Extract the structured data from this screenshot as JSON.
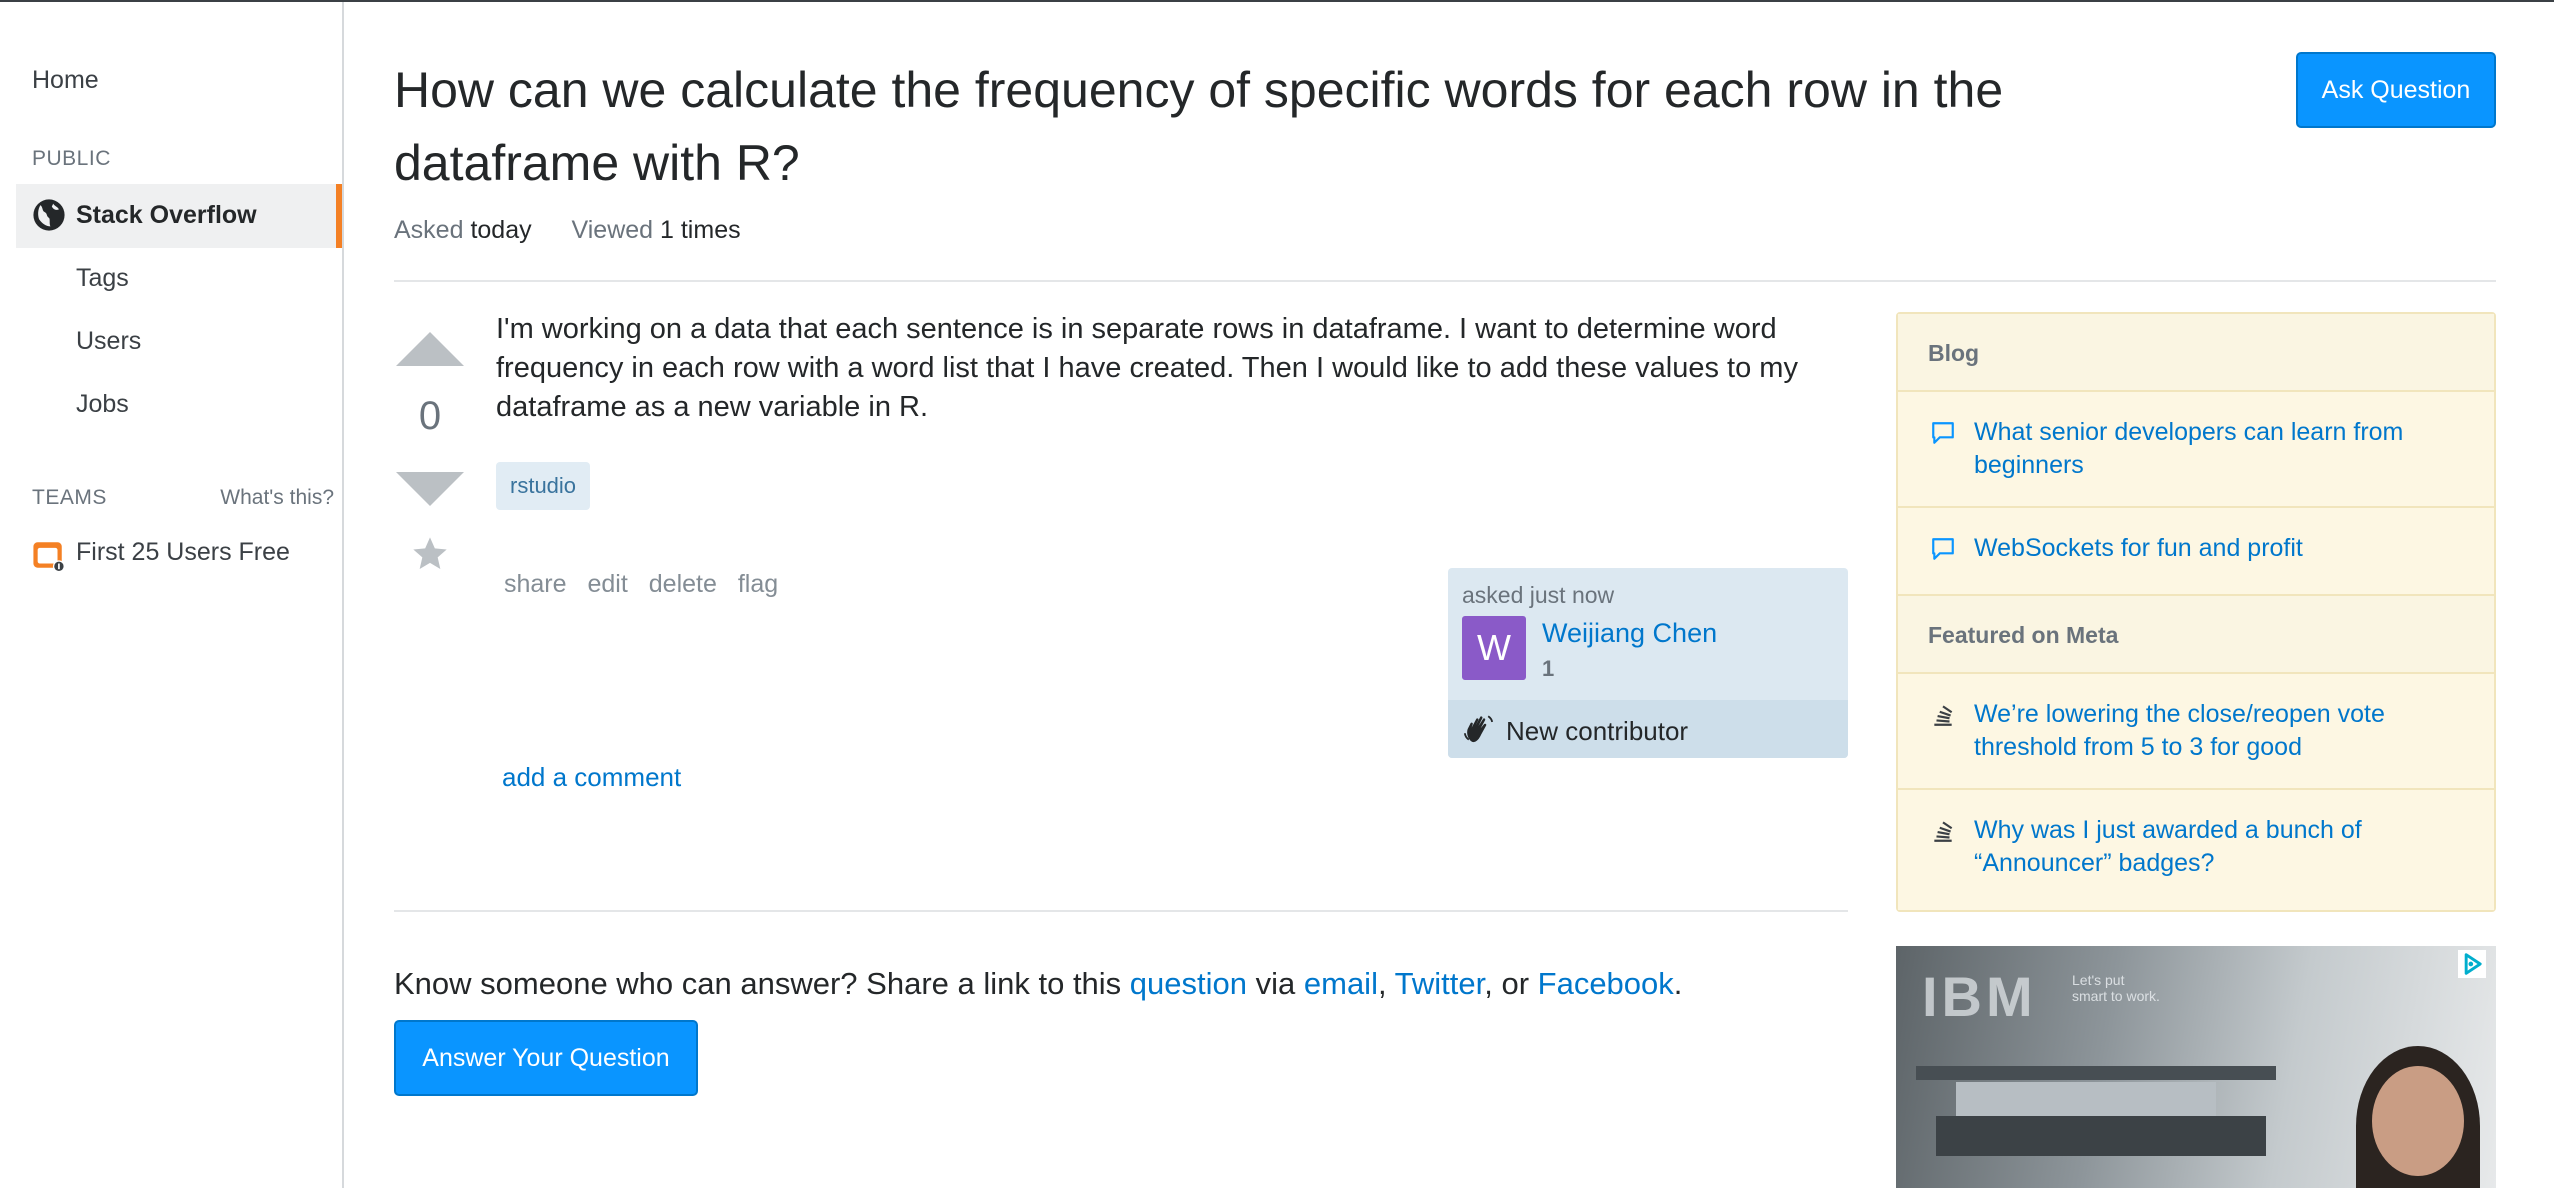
{
  "sidebar": {
    "home": "Home",
    "public_label": "PUBLIC",
    "stack_overflow": "Stack Overflow",
    "tags": "Tags",
    "users": "Users",
    "jobs": "Jobs",
    "teams_label": "TEAMS",
    "whats_this": "What's this?",
    "teams_free": "First 25 Users Free"
  },
  "question": {
    "title": "How can we calculate the frequency of specific words for each row in the dataframe with R?",
    "ask_button": "Ask Question",
    "asked_label": "Asked",
    "asked_value": "today",
    "viewed_label": "Viewed",
    "viewed_value": "1 times",
    "vote_count": "0",
    "body": "I'm working on a data that each sentence is in separate rows in dataframe. I want to determine word frequency in each row with a word list that I have created. Then I would like to add these values to my dataframe as a new variable in R.",
    "tag": "rstudio",
    "menu": {
      "share": "share",
      "edit": "edit",
      "delete": "delete",
      "flag": "flag"
    },
    "owner": {
      "asked_time": "asked just now",
      "avatar_letter": "W",
      "name": "Weijiang Chen",
      "reputation": "1",
      "badge": "New contributor"
    },
    "add_comment": "add a comment"
  },
  "share_prompt": {
    "prefix": "Know someone who can answer? Share a link to this ",
    "question_link": "question",
    "via": " via ",
    "email": "email",
    "comma": ", ",
    "twitter": "Twitter",
    "or": ", or ",
    "facebook": "Facebook",
    "period": "."
  },
  "answer_button": "Answer Your Question",
  "right_sidebar": {
    "blog_header": "Blog",
    "blog_items": [
      "What senior developers can learn from beginners",
      "WebSockets for fun and profit"
    ],
    "meta_header": "Featured on Meta",
    "meta_items": [
      "We’re lowering the close/reopen vote threshold from 5 to 3 for good",
      "Why was I just awarded a bunch of “Announcer” badges?"
    ]
  },
  "ad": {
    "brand": "IBM",
    "tagline": "Let's put smart to work."
  },
  "colors": {
    "accent_orange": "#f48024",
    "primary_blue": "#0a95ff",
    "link_blue": "#0077cc",
    "avatar_purple": "#8a5ac8",
    "widget_yellow": "#fbf3d5"
  }
}
